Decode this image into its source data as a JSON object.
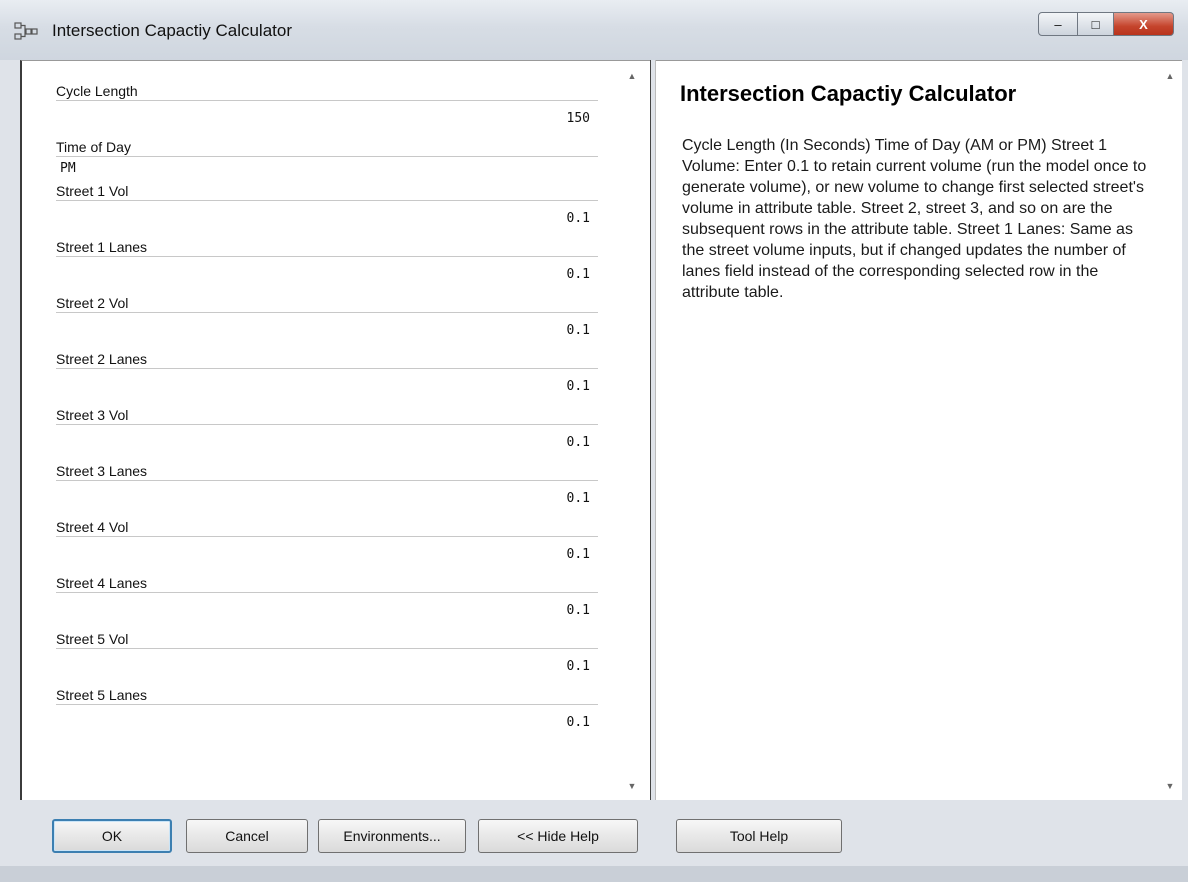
{
  "window": {
    "title": "Intersection Capactiy Calculator",
    "controls": {
      "minimize": "–",
      "maximize": "□",
      "close": "X"
    }
  },
  "params": [
    {
      "label": "Cycle Length",
      "value": "150",
      "kind": "number"
    },
    {
      "label": "Time of Day",
      "value": "PM",
      "kind": "text"
    },
    {
      "label": "Street 1 Vol",
      "value": "0.1",
      "kind": "number"
    },
    {
      "label": "Street 1 Lanes",
      "value": "0.1",
      "kind": "number"
    },
    {
      "label": "Street 2 Vol",
      "value": "0.1",
      "kind": "number"
    },
    {
      "label": "Street 2 Lanes",
      "value": "0.1",
      "kind": "number"
    },
    {
      "label": "Street 3 Vol",
      "value": "0.1",
      "kind": "number"
    },
    {
      "label": "Street 3 Lanes",
      "value": "0.1",
      "kind": "number"
    },
    {
      "label": "Street 4 Vol",
      "value": "0.1",
      "kind": "number"
    },
    {
      "label": "Street 4 Lanes",
      "value": "0.1",
      "kind": "number"
    },
    {
      "label": "Street 5 Vol",
      "value": "0.1",
      "kind": "number"
    },
    {
      "label": "Street 5 Lanes",
      "value": "0.1",
      "kind": "number"
    }
  ],
  "help": {
    "title": "Intersection Capactiy Calculator",
    "body": "Cycle Length (In Seconds) Time of Day (AM or PM) Street 1 Volume: Enter 0.1 to retain current volume (run the model once to generate volume), or new volume to change first selected street's volume in attribute table. Street 2, street 3, and so on are the subsequent rows in the attribute table. Street 1 Lanes: Same as the street volume inputs, but if changed updates the number of lanes field instead of the corresponding selected row in the attribute table."
  },
  "buttons": {
    "ok": "OK",
    "cancel": "Cancel",
    "environments": "Environments...",
    "hide_help": "<< Hide Help",
    "tool_help": "Tool Help"
  },
  "icons": {
    "scroll_up": "▲",
    "scroll_down": "▼"
  }
}
